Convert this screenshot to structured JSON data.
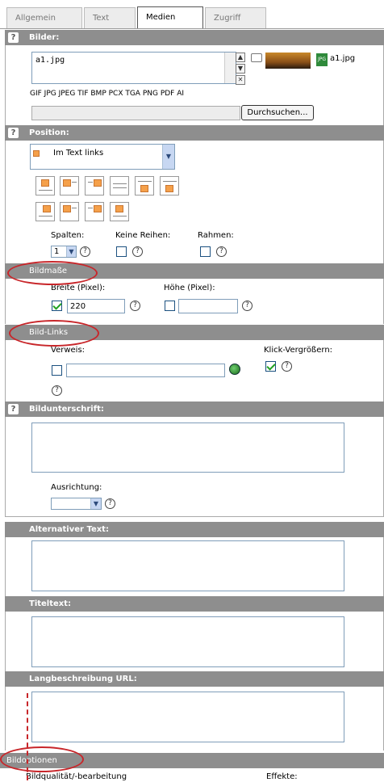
{
  "tabs": [
    {
      "label": "Allgemein",
      "active": false
    },
    {
      "label": "Text",
      "active": false
    },
    {
      "label": "Medien",
      "active": true
    },
    {
      "label": "Zugriff",
      "active": false
    }
  ],
  "bilder": {
    "header": "Bilder:",
    "file_list_value": "a1.jpg",
    "file_name": "a1.jpg",
    "formats": "GIF JPG JPEG TIF BMP PCX TGA PNG PDF AI",
    "browse_label": "Durchsuchen...",
    "file_icon_text": "JPG"
  },
  "position": {
    "header": "Position:",
    "select_value": "Im Text links",
    "spalten_label": "Spalten:",
    "spalten_value": "1",
    "keine_reihen_label": "Keine Reihen:",
    "rahmen_label": "Rahmen:"
  },
  "bildmasse": {
    "header": "Bildmaße",
    "breite_label": "Breite (Pixel):",
    "breite_value": "220",
    "hoehe_label": "Höhe (Pixel):",
    "hoehe_value": ""
  },
  "bild_links": {
    "header": "Bild-Links",
    "verweis_label": "Verweis:",
    "klick_label": "Klick-Vergrößern:"
  },
  "bildunterschrift": {
    "header": "Bildunterschrift:",
    "ausrichtung_label": "Ausrichtung:"
  },
  "alt_text": {
    "header": "Alternativer Text:"
  },
  "titeltext": {
    "header": "Titeltext:"
  },
  "langbeschreibung": {
    "header": "Langbeschreibung URL:"
  },
  "bildoptionen": {
    "header": "Bildoptionen",
    "qualitaet_label": "Bildqualität/-bearbeitung",
    "effekte_label": "Effekte:"
  },
  "help_symbol": "?",
  "colors": {
    "section_header": "#8e8e8e",
    "annotation": "#c8262a",
    "swatch": "#f5a04a"
  }
}
